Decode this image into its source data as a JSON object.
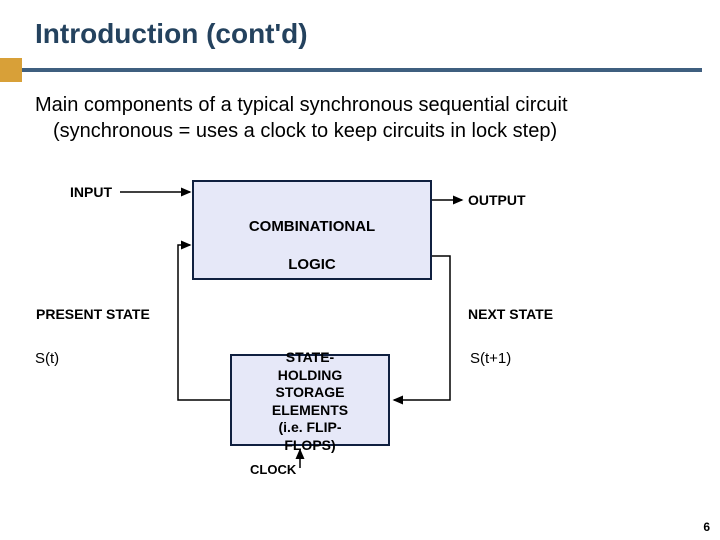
{
  "title": "Introduction (cont'd)",
  "description_line1": "Main components of a typical synchronous sequential circuit",
  "description_line2": "(synchronous = uses a clock to keep circuits in lock step)",
  "labels": {
    "input": "INPUT",
    "output": "OUTPUT",
    "combinational": "COMBINATIONAL",
    "logic": "LOGIC",
    "present_state": "PRESENT STATE",
    "st": "S(t)",
    "next_state": "NEXT STATE",
    "stp1": "S(t+1)",
    "storage_l1": "STATE-",
    "storage_l2": "HOLDING",
    "storage_l3": "STORAGE",
    "storage_l4": "ELEMENTS",
    "storage_l5": "(i.e. FLIP-",
    "storage_l6": "FLOPS)",
    "clock": "CLOCK"
  },
  "page_number": "6"
}
